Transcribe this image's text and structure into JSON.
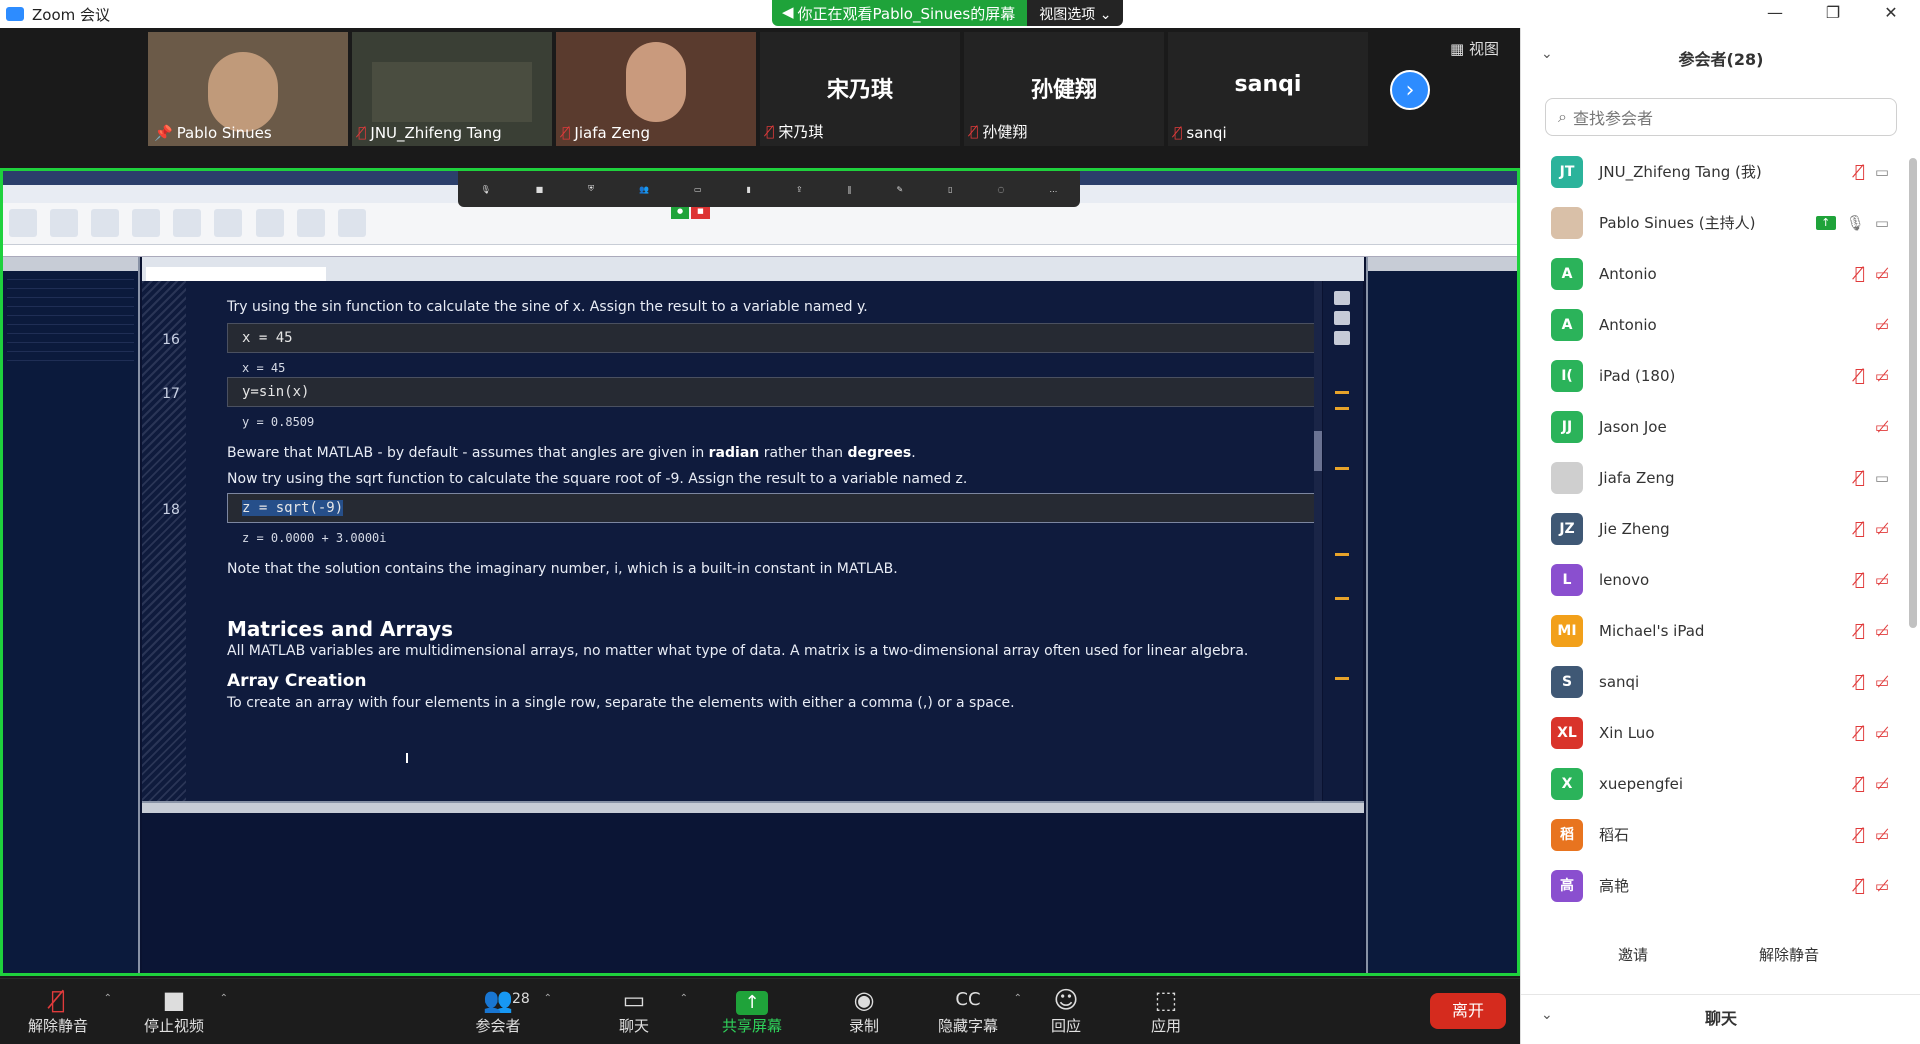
{
  "window": {
    "app_title": "Zoom 会议",
    "view_notice": "你正在观看Pablo_Sinues的屏幕",
    "view_options": "视图选项",
    "controls": [
      "—",
      "❐",
      "✕"
    ]
  },
  "gallery": {
    "view_label": "视图",
    "tiles": [
      {
        "name": "Pablo Sinues",
        "type": "video",
        "muted": false
      },
      {
        "name": "JNU_Zhifeng Tang",
        "type": "video",
        "muted": true
      },
      {
        "name": "Jiafa Zeng",
        "type": "video",
        "muted": true
      },
      {
        "name": "宋乃琪",
        "type": "name",
        "muted": true
      },
      {
        "name": "孙健翔",
        "type": "name",
        "muted": true
      },
      {
        "name": "sanqi",
        "type": "name",
        "muted": true
      }
    ]
  },
  "shared_screen": {
    "editor": {
      "lines": {
        "intro": "Try using the sin function to calculate the sine of x. Assign the result to a variable named y.",
        "beware_pre": "Beware that MATLAB - by default - assumes that angles are given in ",
        "beware_radian": "radian",
        "beware_mid": " rather than ",
        "beware_degrees": "degrees",
        "beware_end": ".",
        "sqrt_intro": "Now try using the sqrt function to calculate the square root of -9. Assign the result to a variable named z.",
        "note_imag": "Note that the solution contains the imaginary number, i, which is a built-in constant in MATLAB.",
        "h_matrices": "Matrices and Arrays",
        "matrices_desc": "All MATLAB variables are multidimensional arrays, no matter what type of data. A matrix is a two-dimensional array often used for linear algebra.",
        "h_array": "Array Creation",
        "array_desc": "To create an array with four elements in a single row, separate the elements with either a comma (,) or a space."
      },
      "cells": [
        {
          "num": "16",
          "code": "x = 45",
          "output": "x = 45"
        },
        {
          "num": "17",
          "code": "y=sin(x)",
          "output": "y = 0.8509"
        },
        {
          "num": "18",
          "code": "z = sqrt(-9)",
          "output": "z = 0.0000 + 3.0000i"
        }
      ]
    }
  },
  "toolbar": {
    "unmute": "解除静音",
    "stop_video": "停止视频",
    "participants": "参会者",
    "participant_count": "28",
    "chat": "聊天",
    "share": "共享屏幕",
    "record": "录制",
    "captions": "隐藏字幕",
    "reactions": "回应",
    "apps": "应用",
    "leave": "离开"
  },
  "panel": {
    "title": "参会者(28)",
    "search_placeholder": "查找参会者",
    "participants": [
      {
        "initials": "JT",
        "color": "#2bb39b",
        "name": "JNU_Zhifeng Tang (我)",
        "mic": "muted",
        "video": "on"
      },
      {
        "initials": "",
        "color": "#d9c0a8",
        "name": "Pablo Sinues (主持人)",
        "mic": "on",
        "video": "on",
        "sharing": true,
        "photo": true
      },
      {
        "initials": "A",
        "color": "#2bb35a",
        "name": "Antonio",
        "mic": "muted",
        "video": "off"
      },
      {
        "initials": "A",
        "color": "#2bb35a",
        "name": "Antonio",
        "mic": "none",
        "video": "off"
      },
      {
        "initials": "I(",
        "color": "#2bb35a",
        "name": "iPad (180)",
        "mic": "muted",
        "video": "off"
      },
      {
        "initials": "JJ",
        "color": "#2bb35a",
        "name": "Jason Joe",
        "mic": "none",
        "video": "off"
      },
      {
        "initials": "",
        "color": "#cfcfcf",
        "name": "Jiafa Zeng",
        "mic": "muted",
        "video": "on",
        "photo": true
      },
      {
        "initials": "JZ",
        "color": "#3f5875",
        "name": "Jie Zheng",
        "mic": "muted",
        "video": "off"
      },
      {
        "initials": "L",
        "color": "#8a4fcf",
        "name": "lenovo",
        "mic": "muted",
        "video": "off"
      },
      {
        "initials": "MI",
        "color": "#f2a01a",
        "name": "Michael's iPad",
        "mic": "muted",
        "video": "off"
      },
      {
        "initials": "S",
        "color": "#3f5875",
        "name": "sanqi",
        "mic": "muted",
        "video": "off"
      },
      {
        "initials": "XL",
        "color": "#d9342b",
        "name": "Xin Luo",
        "mic": "muted",
        "video": "off"
      },
      {
        "initials": "X",
        "color": "#2bb35a",
        "name": "xuepengfei",
        "mic": "muted",
        "video": "off"
      },
      {
        "initials": "稻",
        "color": "#e8741f",
        "name": "稻石",
        "mic": "muted",
        "video": "off"
      },
      {
        "initials": "高",
        "color": "#8a4fcf",
        "name": "高艳",
        "mic": "muted",
        "video": "off"
      }
    ],
    "invite": "邀请",
    "unmute_me": "解除静音",
    "chat_title": "聊天"
  }
}
